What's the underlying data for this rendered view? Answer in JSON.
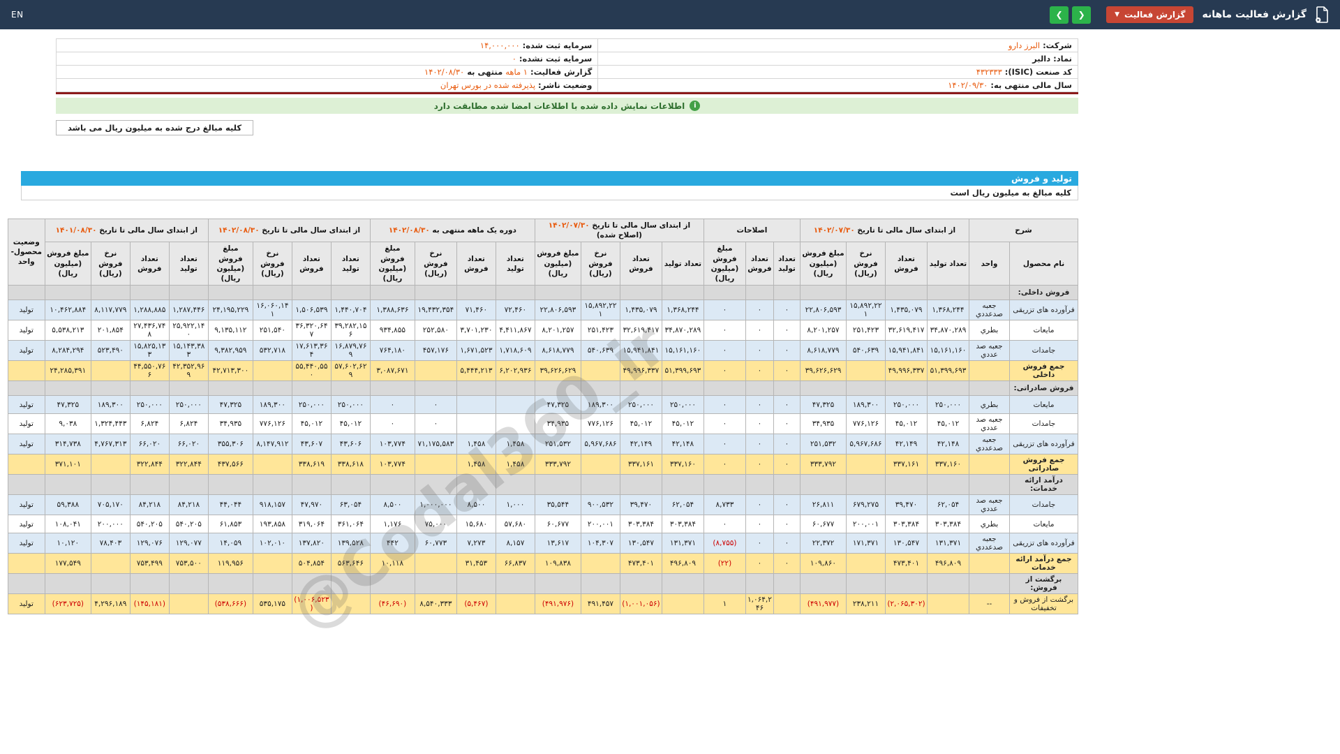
{
  "topbar": {
    "title": "گزارش فعالیت ماهانه",
    "report_button": "گزارش فعالیت",
    "caret": "▼",
    "prev_arrow": "❮",
    "next_arrow": "❯",
    "en_label": "EN"
  },
  "info": {
    "rows": [
      {
        "right": [
          {
            "t": "شرکت: ",
            "c": "lbl"
          },
          {
            "t": "البرز دارو",
            "c": "val"
          }
        ],
        "left": [
          {
            "t": "سرمایه ثبت شده: ",
            "c": "lbl"
          },
          {
            "t": "۱۴,۰۰۰,۰۰۰",
            "c": "val"
          }
        ]
      },
      {
        "right": [
          {
            "t": "نماد: ",
            "c": "lbl"
          },
          {
            "t": "دالبر",
            "c": "vald"
          }
        ],
        "left": [
          {
            "t": "سرمایه ثبت نشده: ",
            "c": "lbl"
          },
          {
            "t": "۰",
            "c": "val"
          }
        ]
      },
      {
        "right": [
          {
            "t": "کد صنعت (ISIC): ",
            "c": "lbl"
          },
          {
            "t": "۴۳۲۳۳۳",
            "c": "val"
          }
        ],
        "left": [
          {
            "t": "گزارش فعالیت: ",
            "c": "lbl"
          },
          {
            "t": "۱ ماهه",
            "c": "val"
          },
          {
            "t": " منتهی به ",
            "c": "lbl"
          },
          {
            "t": "۱۴۰۲/۰۸/۳۰",
            "c": "val"
          }
        ]
      },
      {
        "right": [
          {
            "t": "سال مالی منتهی به: ",
            "c": "lbl"
          },
          {
            "t": "۱۴۰۲/۰۹/۳۰",
            "c": "val"
          }
        ],
        "left": [
          {
            "t": "وضعیت ناشر: ",
            "c": "lbl"
          },
          {
            "t": "پذیرفته شده در بورس تهران",
            "c": "val"
          }
        ]
      }
    ]
  },
  "banner": {
    "icon": "i",
    "text": "اطلاعات نمایش داده شده با اطلاعات امضا شده مطابقت دارد"
  },
  "notes": {
    "amounts_box": "کلیه مبالغ درج شده به میلیون ریال می باشد"
  },
  "production_section": {
    "title": "تولید و فروش",
    "note": "کلیه مبالغ به میلیون ریال است"
  },
  "watermark": "@Codal360_ir",
  "colors": {
    "topbar": "#273a52",
    "accent_orange": "#e8590c",
    "report_button": "#c74634",
    "nav_green": "#2cb34a",
    "banner_green": "#ddf0d5",
    "section_blue_bar": "#29a9df",
    "row_blue": "#dce9f5",
    "row_total_yellow": "#ffe699",
    "row_section_gray": "#d9d9d9",
    "negative_red": "#cc0000"
  },
  "table": {
    "col_desc": "شرح",
    "col_product": "نام محصول",
    "col_unit": "واحد",
    "col_status": "وضعیت محصول- واحد",
    "groups": [
      {
        "title": "از ابتدای سال مالی تا تاریخ",
        "date": "۱۴۰۲/۰۷/۳۰",
        "suffix": "",
        "cols": [
          "تعداد تولید",
          "تعداد فروش",
          "نرخ فروش (ریال)",
          "مبلغ فروش (میلیون ریال)"
        ]
      },
      {
        "title": "اصلاحات",
        "date": "",
        "suffix": "",
        "cols": [
          "تعداد تولید",
          "تعداد فروش",
          "مبلغ فروش (میلیون ریال)"
        ]
      },
      {
        "title": "از ابتدای سال مالی تا تاریخ",
        "date": "۱۴۰۲/۰۷/۳۰",
        "suffix": "(اصلاح شده)",
        "cols": [
          "تعداد تولید",
          "تعداد فروش",
          "نرخ فروش (ریال)",
          "مبلغ فروش (میلیون ریال)"
        ]
      },
      {
        "title": "دوره یک ماهه منتهی به",
        "date": "۱۴۰۲/۰۸/۳۰",
        "suffix": "",
        "cols": [
          "تعداد تولید",
          "تعداد فروش",
          "نرخ فروش (ریال)",
          "مبلغ فروش (میلیون ریال)"
        ]
      },
      {
        "title": "از ابتدای سال مالی تا تاریخ",
        "date": "۱۴۰۲/۰۸/۳۰",
        "suffix": "",
        "cols": [
          "تعداد تولید",
          "تعداد فروش",
          "نرخ فروش (ریال)",
          "مبلغ فروش (میلیون ریال)"
        ]
      },
      {
        "title": "از ابتدای سال مالی تا تاریخ",
        "date": "۱۴۰۱/۰۸/۳۰",
        "suffix": "",
        "cols": [
          "تعداد تولید",
          "تعداد فروش",
          "نرخ فروش (ریال)",
          "مبلغ فروش (میلیون ریال)"
        ]
      }
    ],
    "rows": [
      {
        "type": "section",
        "shade": "section",
        "product": "فروش داخلی:",
        "unit": "",
        "status": "",
        "cells": []
      },
      {
        "type": "data",
        "shade": "blue",
        "product": "فرآورده های تزریقی",
        "unit": "جعبه صدعددي",
        "status": "تولید",
        "cells": [
          "۱,۳۶۸,۲۴۴",
          "۱,۴۳۵,۰۷۹",
          "۱۵,۸۹۲,۲۲۱",
          "۲۲,۸۰۶,۵۹۳",
          "۰",
          "۰",
          "۰",
          "۱,۳۶۸,۲۴۴",
          "۱,۴۳۵,۰۷۹",
          "۱۵,۸۹۲,۲۲۱",
          "۲۲,۸۰۶,۵۹۳",
          "۷۲,۴۶۰",
          "۷۱,۴۶۰",
          "۱۹,۴۳۲,۳۵۴",
          "۱,۳۸۸,۶۳۶",
          "۱,۴۴۰,۷۰۴",
          "۱,۵۰۶,۵۳۹",
          "۱۶,۰۶۰,۱۴۱",
          "۲۴,۱۹۵,۲۲۹",
          "۱,۲۸۷,۴۴۶",
          "۱,۲۸۸,۸۸۵",
          "۸,۱۱۷,۷۷۹",
          "۱۰,۴۶۲,۸۸۴"
        ]
      },
      {
        "type": "data",
        "shade": "white",
        "product": "مایعات",
        "unit": "بطري",
        "status": "تولید",
        "cells": [
          "۳۴,۸۷۰,۲۸۹",
          "۳۲,۶۱۹,۴۱۷",
          "۲۵۱,۴۲۳",
          "۸,۲۰۱,۲۵۷",
          "۰",
          "۰",
          "۰",
          "۳۴,۸۷۰,۲۸۹",
          "۳۲,۶۱۹,۴۱۷",
          "۲۵۱,۴۲۳",
          "۸,۲۰۱,۲۵۷",
          "۴,۴۱۱,۸۶۷",
          "۳,۷۰۱,۲۳۰",
          "۲۵۲,۵۸۰",
          "۹۳۴,۸۵۵",
          "۳۹,۲۸۲,۱۵۶",
          "۳۶,۳۲۰,۶۴۷",
          "۲۵۱,۵۴۰",
          "۹,۱۳۵,۱۱۲",
          "۲۵,۹۲۲,۱۴۰",
          "۲۷,۴۳۶,۷۴۸",
          "۲۰۱,۸۵۴",
          "۵,۵۳۸,۲۱۳"
        ]
      },
      {
        "type": "data",
        "shade": "blue",
        "product": "جامدات",
        "unit": "جعبه صد عددي",
        "status": "تولید",
        "cells": [
          "۱۵,۱۶۱,۱۶۰",
          "۱۵,۹۴۱,۸۴۱",
          "۵۴۰,۶۳۹",
          "۸,۶۱۸,۷۷۹",
          "۰",
          "۰",
          "۰",
          "۱۵,۱۶۱,۱۶۰",
          "۱۵,۹۴۱,۸۴۱",
          "۵۴۰,۶۳۹",
          "۸,۶۱۸,۷۷۹",
          "۱,۷۱۸,۶۰۹",
          "۱,۶۷۱,۵۲۳",
          "۴۵۷,۱۷۶",
          "۷۶۴,۱۸۰",
          "۱۶,۸۷۹,۷۶۹",
          "۱۷,۶۱۳,۳۶۴",
          "۵۳۲,۷۱۸",
          "۹,۳۸۲,۹۵۹",
          "۱۵,۱۴۳,۳۸۳",
          "۱۵,۸۲۵,۱۳۳",
          "۵۲۳,۴۹۰",
          "۸,۲۸۴,۲۹۴"
        ]
      },
      {
        "type": "total",
        "shade": "total",
        "product": "جمع فروش داخلی",
        "unit": "",
        "status": "",
        "cells": [
          "۵۱,۳۹۹,۶۹۳",
          "۴۹,۹۹۶,۳۳۷",
          "",
          "۳۹,۶۲۶,۶۲۹",
          "۰",
          "۰",
          "۰",
          "۵۱,۳۹۹,۶۹۳",
          "۴۹,۹۹۶,۳۳۷",
          "",
          "۳۹,۶۲۶,۶۲۹",
          "۶,۲۰۲,۹۳۶",
          "۵,۴۴۴,۲۱۳",
          "",
          "۳,۰۸۷,۶۷۱",
          "۵۷,۶۰۲,۶۲۹",
          "۵۵,۴۴۰,۵۵۰",
          "",
          "۴۲,۷۱۳,۳۰۰",
          "۴۲,۳۵۲,۹۶۹",
          "۴۴,۵۵۰,۷۶۶",
          "",
          "۲۴,۲۸۵,۳۹۱"
        ]
      },
      {
        "type": "section",
        "shade": "section",
        "product": "فروش صادراتی:",
        "unit": "",
        "status": "",
        "cells": []
      },
      {
        "type": "data",
        "shade": "blue",
        "product": "مایعات",
        "unit": "بطري",
        "status": "تولید",
        "cells": [
          "۲۵۰,۰۰۰",
          "۲۵۰,۰۰۰",
          "۱۸۹,۳۰۰",
          "۴۷,۳۲۵",
          "۰",
          "۰",
          "۰",
          "۲۵۰,۰۰۰",
          "۲۵۰,۰۰۰",
          "۱۸۹,۳۰۰",
          "۴۷,۳۲۵",
          "",
          "",
          "۰",
          "۰",
          "۲۵۰,۰۰۰",
          "۲۵۰,۰۰۰",
          "۱۸۹,۳۰۰",
          "۴۷,۳۲۵",
          "۲۵۰,۰۰۰",
          "۲۵۰,۰۰۰",
          "۱۸۹,۳۰۰",
          "۴۷,۳۲۵"
        ]
      },
      {
        "type": "data",
        "shade": "white",
        "product": "جامدات",
        "unit": "جعبه صد عددي",
        "status": "تولید",
        "cells": [
          "۴۵,۰۱۲",
          "۴۵,۰۱۲",
          "۷۷۶,۱۲۶",
          "۳۴,۹۳۵",
          "۰",
          "۰",
          "۰",
          "۴۵,۰۱۲",
          "۴۵,۰۱۲",
          "۷۷۶,۱۲۶",
          "۳۴,۹۳۵",
          "",
          "",
          "۰",
          "۰",
          "۴۵,۰۱۲",
          "۴۵,۰۱۲",
          "۷۷۶,۱۲۶",
          "۳۴,۹۳۵",
          "۶,۸۲۴",
          "۶,۸۲۴",
          "۱,۳۲۴,۴۴۳",
          "۹,۰۳۸"
        ]
      },
      {
        "type": "data",
        "shade": "blue",
        "product": "فرآورده های تزریقی",
        "unit": "جعبه صدعددي",
        "status": "تولید",
        "cells": [
          "۴۲,۱۴۸",
          "۴۲,۱۴۹",
          "۵,۹۶۷,۶۸۶",
          "۲۵۱,۵۳۲",
          "۰",
          "۰",
          "۰",
          "۴۲,۱۴۸",
          "۴۲,۱۴۹",
          "۵,۹۶۷,۶۸۶",
          "۲۵۱,۵۳۲",
          "۱,۴۵۸",
          "۱,۴۵۸",
          "۷۱,۱۷۵,۵۸۳",
          "۱۰۳,۷۷۴",
          "۴۳,۶۰۶",
          "۴۳,۶۰۷",
          "۸,۱۴۷,۹۱۲",
          "۳۵۵,۳۰۶",
          "۶۶,۰۲۰",
          "۶۶,۰۲۰",
          "۴,۷۶۷,۳۱۳",
          "۳۱۴,۷۳۸"
        ]
      },
      {
        "type": "total",
        "shade": "total",
        "product": "جمع فروش صادراتی",
        "unit": "",
        "status": "",
        "cells": [
          "۳۳۷,۱۶۰",
          "۳۳۷,۱۶۱",
          "",
          "۳۳۳,۷۹۲",
          "۰",
          "۰",
          "۰",
          "۳۳۷,۱۶۰",
          "۳۳۷,۱۶۱",
          "",
          "۳۳۳,۷۹۲",
          "۱,۴۵۸",
          "۱,۴۵۸",
          "",
          "۱۰۳,۷۷۴",
          "۳۳۸,۶۱۸",
          "۳۳۸,۶۱۹",
          "",
          "۴۳۷,۵۶۶",
          "۳۲۲,۸۴۴",
          "۳۲۲,۸۴۴",
          "",
          "۳۷۱,۱۰۱"
        ]
      },
      {
        "type": "section",
        "shade": "section",
        "product": "درآمد ارائه خدمات:",
        "unit": "",
        "status": "",
        "cells": []
      },
      {
        "type": "data",
        "shade": "blue",
        "product": "جامدات",
        "unit": "جعبه صد عددي",
        "status": "تولید",
        "cells": [
          "۶۲,۰۵۴",
          "۳۹,۴۷۰",
          "۶۷۹,۲۷۵",
          "۲۶,۸۱۱",
          "۰",
          "۰",
          "۸,۷۳۳",
          "۶۲,۰۵۴",
          "۳۹,۴۷۰",
          "۹۰۰,۵۳۲",
          "۳۵,۵۴۴",
          "۱,۰۰۰",
          "۸,۵۰۰",
          "۱,۰۰۰,۰۰۰",
          "۸,۵۰۰",
          "۶۳,۰۵۴",
          "۴۷,۹۷۰",
          "۹۱۸,۱۵۷",
          "۴۴,۰۴۴",
          "۸۴,۲۱۸",
          "۸۴,۲۱۸",
          "۷۰۵,۱۷۰",
          "۵۹,۳۸۸"
        ]
      },
      {
        "type": "data",
        "shade": "white",
        "product": "مایعات",
        "unit": "بطري",
        "status": "تولید",
        "cells": [
          "۳۰۳,۳۸۴",
          "۳۰۳,۳۸۴",
          "۲۰۰,۰۰۱",
          "۶۰,۶۷۷",
          "۰",
          "۰",
          "۰",
          "۳۰۳,۳۸۴",
          "۳۰۳,۳۸۴",
          "۲۰۰,۰۰۱",
          "۶۰,۶۷۷",
          "۵۷,۶۸۰",
          "۱۵,۶۸۰",
          "۷۵,۰۰۰",
          "۱,۱۷۶",
          "۳۶۱,۰۶۴",
          "۳۱۹,۰۶۴",
          "۱۹۳,۸۵۸",
          "۶۱,۸۵۳",
          "۵۴۰,۲۰۵",
          "۵۴۰,۲۰۵",
          "۲۰۰,۰۰۰",
          "۱۰۸,۰۴۱"
        ]
      },
      {
        "type": "data",
        "shade": "blue",
        "product": "فرآورده های تزریقی",
        "unit": "جعبه صدعددي",
        "status": "تولید",
        "cells": [
          "۱۳۱,۳۷۱",
          "۱۳۰,۵۴۷",
          "۱۷۱,۳۷۱",
          "۲۲,۳۷۲",
          "۰",
          "۰",
          "(۸,۷۵۵)",
          "۱۳۱,۳۷۱",
          "۱۳۰,۵۴۷",
          "۱۰۴,۳۰۷",
          "۱۳,۶۱۷",
          "۸,۱۵۷",
          "۷,۲۷۳",
          "۶۰,۷۷۳",
          "۴۴۲",
          "۱۳۹,۵۲۸",
          "۱۳۷,۸۲۰",
          "۱۰۲,۰۱۰",
          "۱۴,۰۵۹",
          "۱۲۹,۰۷۷",
          "۱۲۹,۰۷۶",
          "۷۸,۴۰۳",
          "۱۰,۱۲۰"
        ]
      },
      {
        "type": "total",
        "shade": "total",
        "product": "جمع درآمد ارائه خدمات",
        "unit": "",
        "status": "",
        "cells": [
          "۴۹۶,۸۰۹",
          "۴۷۳,۴۰۱",
          "",
          "۱۰۹,۸۶۰",
          "۰",
          "۰",
          "(۲۲)",
          "۴۹۶,۸۰۹",
          "۴۷۳,۴۰۱",
          "",
          "۱۰۹,۸۳۸",
          "۶۶,۸۳۷",
          "۳۱,۴۵۳",
          "",
          "۱۰,۱۱۸",
          "۵۶۳,۶۴۶",
          "۵۰۴,۸۵۴",
          "",
          "۱۱۹,۹۵۶",
          "۷۵۳,۵۰۰",
          "۷۵۳,۴۹۹",
          "",
          "۱۷۷,۵۴۹"
        ]
      },
      {
        "type": "section",
        "shade": "section",
        "product": "برگشت از فروش:",
        "unit": "",
        "status": "",
        "cells": []
      },
      {
        "type": "data",
        "shade": "return",
        "product": "برگشت از فروش و تخفیفات",
        "unit": "--",
        "status": "تولید",
        "cells": [
          "",
          "(۲,۰۶۵,۳۰۲)",
          "۲۳۸,۲۱۱",
          "(۴۹۱,۹۷۷)",
          "",
          "۱,۰۶۴,۲۴۶",
          "۱",
          "",
          "(۱,۰۰۱,۰۵۶)",
          "۴۹۱,۴۵۷",
          "(۴۹۱,۹۷۶)",
          "",
          "(۵,۴۶۷)",
          "۸,۵۴۰,۳۳۳",
          "(۴۶,۶۹۰)",
          "",
          "(۱,۰۰۶,۵۲۳)",
          "۵۳۵,۱۷۵",
          "(۵۳۸,۶۶۶)",
          "",
          "(۱۴۵,۱۸۱)",
          "۴,۲۹۶,۱۸۹",
          "(۶۲۳,۷۲۵)"
        ]
      }
    ]
  }
}
